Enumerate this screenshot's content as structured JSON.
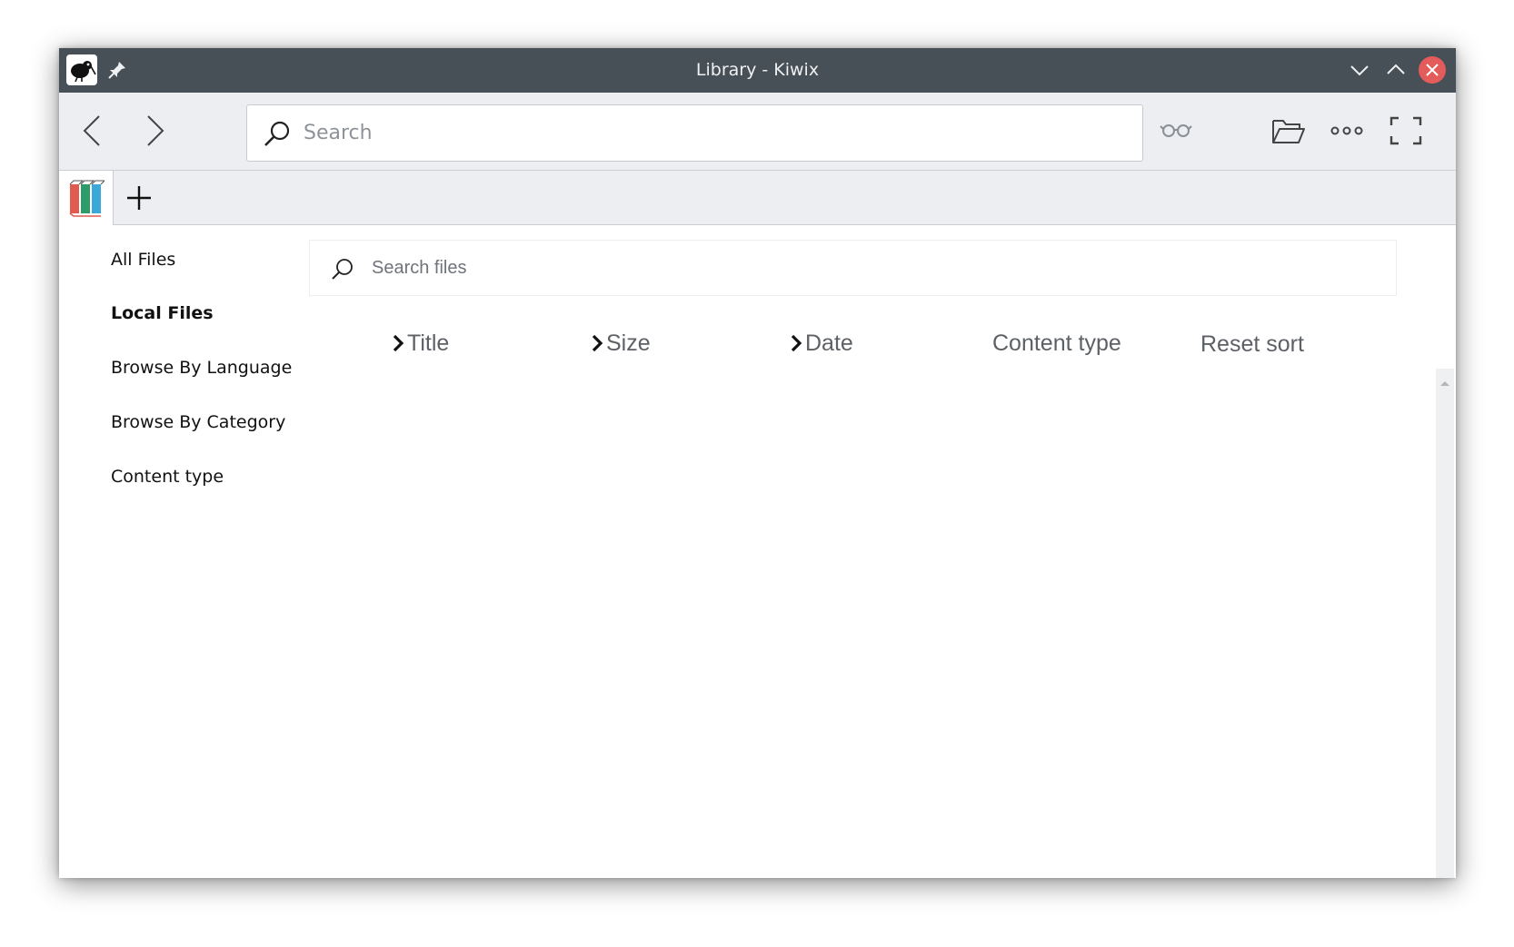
{
  "window": {
    "title": "Library - Kiwix"
  },
  "toolbar": {
    "search_placeholder": "Search"
  },
  "sidebar": {
    "items": [
      {
        "label": "All Files"
      },
      {
        "label": "Local Files",
        "active": true
      },
      {
        "label": "Browse By Language"
      },
      {
        "label": "Browse By Category"
      },
      {
        "label": "Content type"
      }
    ]
  },
  "library": {
    "filter_placeholder": "Search files",
    "columns": [
      {
        "label": "Title",
        "sort_arrow": true
      },
      {
        "label": "Size",
        "sort_arrow": true
      },
      {
        "label": "Date",
        "sort_arrow": true
      },
      {
        "label": "Content type",
        "sort_arrow": false
      }
    ],
    "reset_sort_label": "Reset sort"
  },
  "colors": {
    "titlebar": "#475057",
    "toolbar": "#eceef1",
    "close_button": "#e35b5b",
    "library_icon_red": "#e05a4f",
    "library_icon_green": "#2e9b6b",
    "library_icon_blue": "#3aa8d8"
  },
  "icons": [
    "kiwix-app-icon",
    "pin-icon",
    "minimize-icon",
    "maximize-icon",
    "close-icon",
    "back-arrow-icon",
    "forward-arrow-icon",
    "search-icon",
    "reading-glasses-icon",
    "open-folder-icon",
    "more-icon",
    "fullscreen-icon",
    "library-tab-icon",
    "plus-icon",
    "chevron-right-icon",
    "scroll-up-icon"
  ]
}
